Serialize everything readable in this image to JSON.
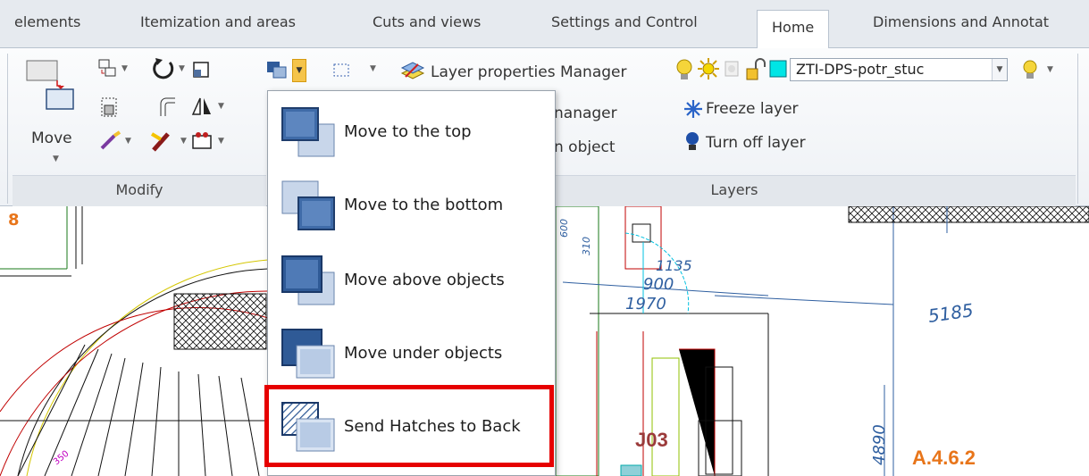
{
  "tabs": [
    {
      "label": "elements",
      "active": false
    },
    {
      "label": "Itemization and areas",
      "active": false
    },
    {
      "label": "Cuts and views",
      "active": false
    },
    {
      "label": "Settings and Control",
      "active": false
    },
    {
      "label": "Home",
      "active": true
    },
    {
      "label": "Dimensions and Annotat",
      "active": false
    }
  ],
  "ribbon": {
    "modify_group": {
      "title": "Modify",
      "move_label": "Move"
    },
    "layers_group": {
      "title": "Layers",
      "layer_properties_manager": "Layer properties Manager",
      "layer_states_manager_partial": "nanager",
      "layer_match_partial": "n object",
      "freeze_layer": "Freeze layer",
      "turn_off_layer": "Turn off layer",
      "current_layer": "ZTI-DPS-potr_stuc"
    }
  },
  "menu": {
    "items": [
      {
        "label": "Move to the top",
        "icon": "move-to-top-icon"
      },
      {
        "label": "Move to the bottom",
        "icon": "move-to-bottom-icon"
      },
      {
        "label": "Move above objects",
        "icon": "move-above-objects-icon"
      },
      {
        "label": "Move under objects",
        "icon": "move-under-objects-icon"
      },
      {
        "label": "Send Hatches to Back",
        "icon": "send-hatches-to-back-icon",
        "highlighted": true
      }
    ]
  },
  "drawing": {
    "sheet_number": "8",
    "dims": [
      "600",
      "310",
      "1135",
      "900",
      "1970",
      "5185",
      "4890",
      "350"
    ],
    "room_tag": "J03",
    "zone_tag": "A.4.6.2"
  },
  "colors": {
    "tab_bar_bg": "#e6eaef",
    "ribbon_bg": "#eef1f5",
    "highlight_border": "#e60000",
    "zone_tag_color": "#e8751a",
    "room_tag_color": "#9b3a3a",
    "layer_color_swatch": "#00e5e5"
  }
}
